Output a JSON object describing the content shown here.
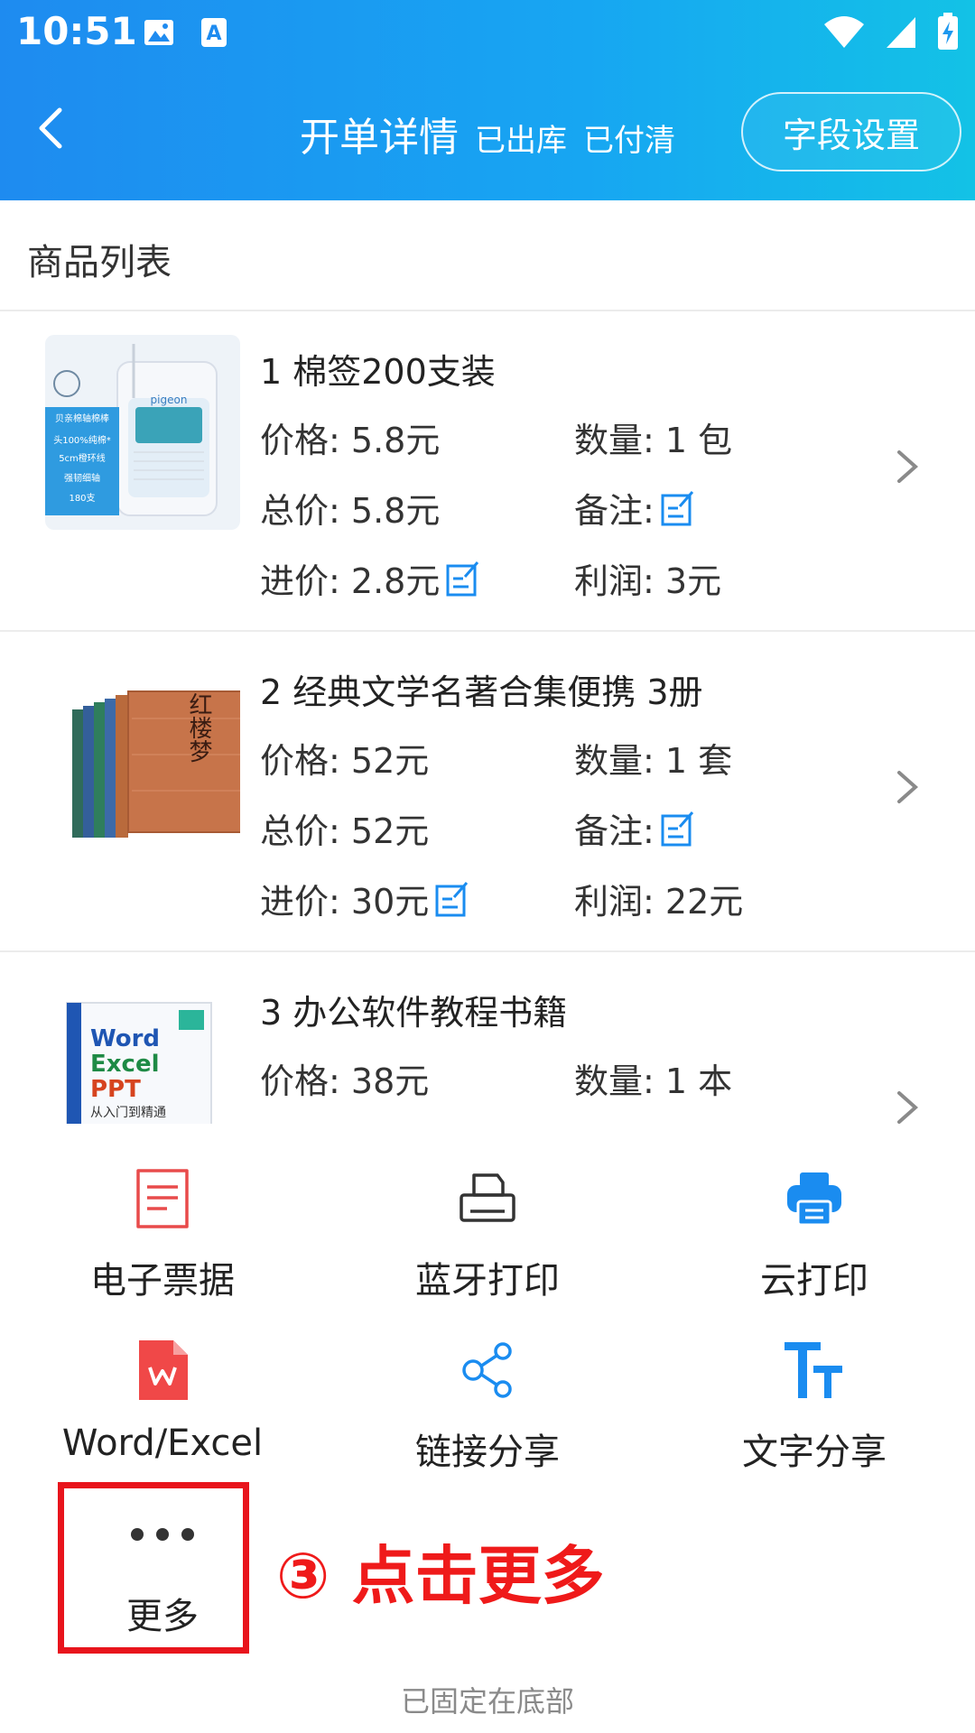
{
  "status_bar": {
    "time": "10:51"
  },
  "nav": {
    "title": "开单详情",
    "status_shipped": "已出库",
    "status_paid": "已付清",
    "field_settings_label": "字段设置"
  },
  "list": {
    "section_title": "商品列表",
    "products": [
      {
        "name": "1 棉签200支装",
        "price_label": "价格:",
        "price": "5.8元",
        "qty_label": "数量:",
        "qty": "1 包",
        "total_label": "总价:",
        "total": "5.8元",
        "remark_label": "备注:",
        "cost_label": "进价:",
        "cost": "2.8元",
        "profit_label": "利润:",
        "profit": "3元",
        "thumb_text": [
          "贝亲棉轴棉棒",
          "头100%纯棉*",
          "5cm橙环线",
          "强韧细轴",
          "180支"
        ],
        "thumb_brand": "pigeon"
      },
      {
        "name": "2 经典文学名著合集便携 3册",
        "price_label": "价格:",
        "price": "52元",
        "qty_label": "数量:",
        "qty": "1 套",
        "total_label": "总价:",
        "total": "52元",
        "remark_label": "备注:",
        "cost_label": "进价:",
        "cost": "30元",
        "profit_label": "利润:",
        "profit": "22元",
        "thumb_text": "红楼梦"
      },
      {
        "name": "3 办公软件教程书籍",
        "price_label": "价格:",
        "price": "38元",
        "qty_label": "数量:",
        "qty": "1 本",
        "thumb_text": [
          "Word",
          "Excel",
          "PPT",
          "从入门到精通"
        ]
      }
    ]
  },
  "actions": [
    {
      "label": "电子票据",
      "icon": "receipt-icon"
    },
    {
      "label": "蓝牙打印",
      "icon": "bluetooth-printer-icon"
    },
    {
      "label": "云打印",
      "icon": "cloud-printer-icon"
    },
    {
      "label": "Word/Excel",
      "icon": "wps-file-icon"
    },
    {
      "label": "链接分享",
      "icon": "share-icon"
    },
    {
      "label": "文字分享",
      "icon": "text-size-icon"
    },
    {
      "label": "更多",
      "icon": "more-dots-icon"
    }
  ],
  "annotation": "③ 点击更多",
  "footer_note": "已固定在底部",
  "colors": {
    "header_start": "#1e8bf0",
    "header_end": "#13c2e6",
    "accent_blue": "#1a8cf0",
    "receipt_red": "#e84b4b",
    "wps_red": "#f04848",
    "annotation_red": "#ef1a1a"
  }
}
